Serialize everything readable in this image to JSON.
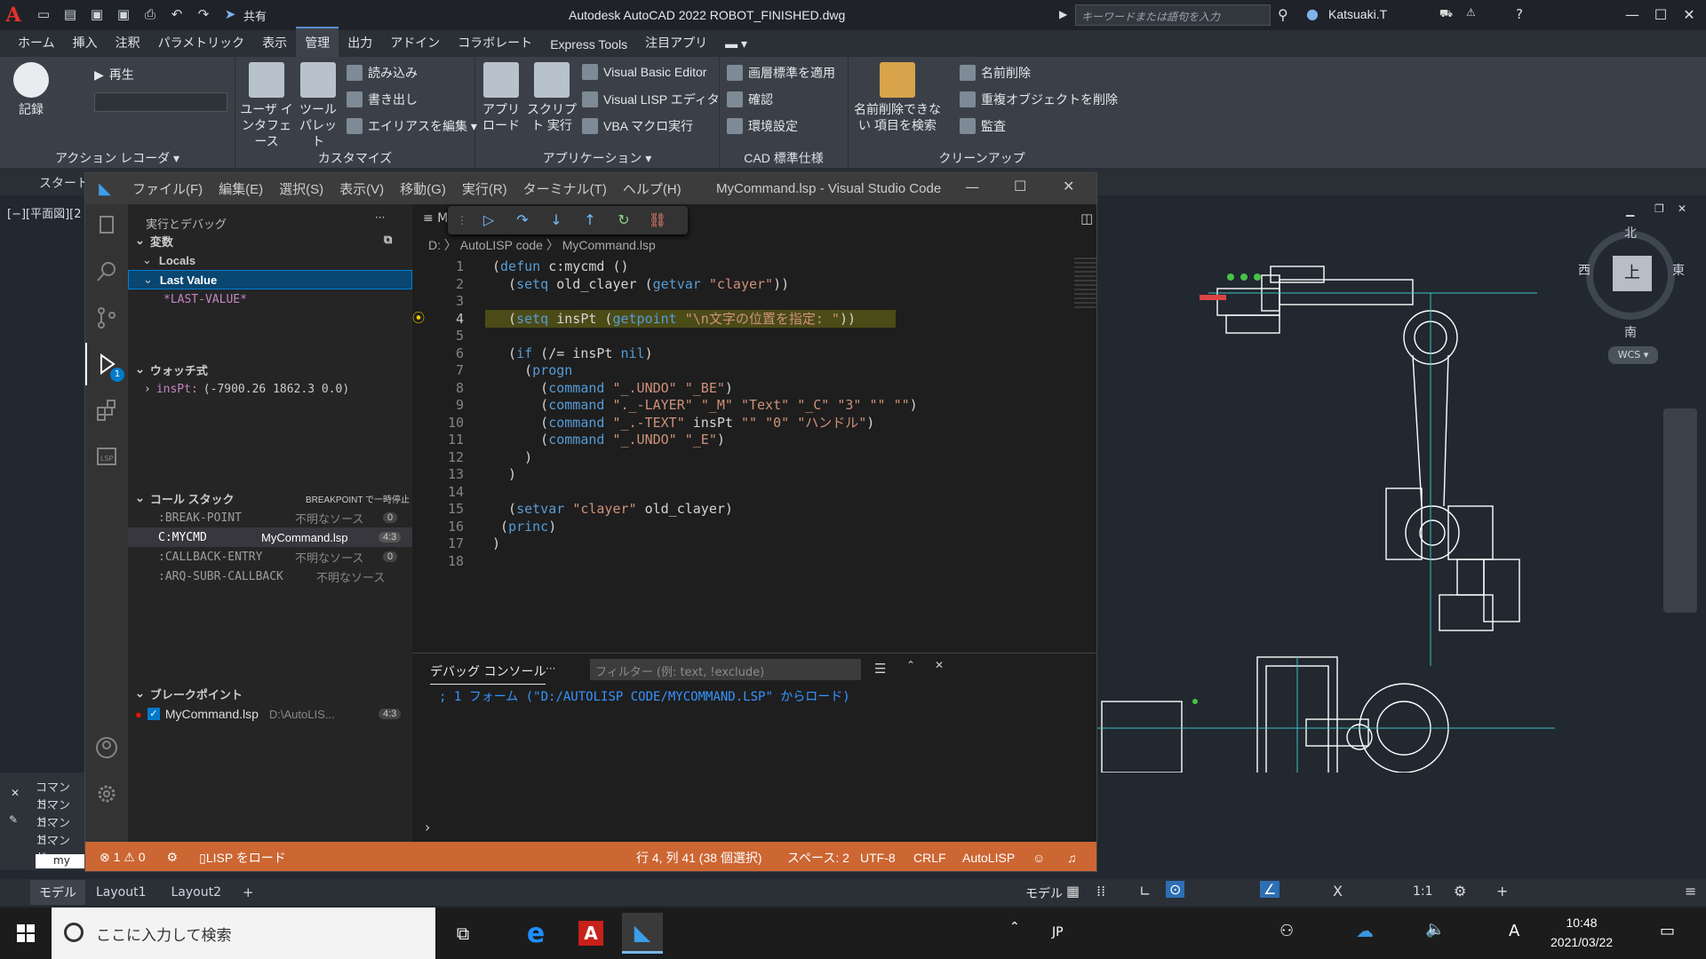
{
  "acad": {
    "title": "Autodesk AutoCAD 2022    ROBOT_FINISHED.dwg",
    "share": "共有",
    "search_placeholder": "キーワードまたは語句を入力",
    "user": "Katsuaki.T",
    "tabs": [
      "ホーム",
      "挿入",
      "注釈",
      "パラメトリック",
      "表示",
      "管理",
      "出力",
      "アドイン",
      "コラボレート",
      "Express Tools",
      "注目アプリ"
    ],
    "active_tab": "管理",
    "ribbon": {
      "action_recorder": {
        "record": "記録",
        "play": "再生",
        "label": "アクション レコーダ ▾"
      },
      "customize": {
        "ui": "ユーザ インタフェース",
        "tool": "ツール パレット",
        "import": "読み込み",
        "export": "書き出し",
        "alias": "エイリアスを編集 ▾",
        "label": "カスタマイズ"
      },
      "applications": {
        "load": "アプリ ロード",
        "script": "スクリプト 実行",
        "vbe": "Visual Basic Editor",
        "vlisp": "Visual LISP エディタ",
        "vba": "VBA マクロ実行",
        "label": "アプリケーション ▾"
      },
      "cad_standards": {
        "apply": "画層標準を適用",
        "check": "確認",
        "config": "環境設定",
        "label": "CAD 標準仕様"
      },
      "cleanup": {
        "find": "名前削除できない 項目を検索",
        "purge": "名前削除",
        "overkill": "重複オブジェクトを削除",
        "audit": "監査",
        "label": "クリーンアップ"
      }
    },
    "file_tab": "スタート",
    "viewport_label": "[−][平面図][2",
    "viewcube": {
      "north": "北",
      "south": "南",
      "east": "東",
      "west": "西",
      "top": "上",
      "wcs": "WCS ▾"
    },
    "command_lines": [
      "コマンド:",
      "コマンド:",
      "コマンド:",
      "コマンド:"
    ],
    "command_input": "my",
    "layout_tabs": [
      "モデル",
      "Layout1",
      "Layout2",
      "+"
    ],
    "status_model": "モデル",
    "status_scale": "1:1"
  },
  "vscode": {
    "menu": [
      "ファイル(F)",
      "編集(E)",
      "選択(S)",
      "表示(V)",
      "移動(G)",
      "実行(R)",
      "ターミナル(T)",
      "ヘルプ(H)"
    ],
    "window_title": "MyCommand.lsp - Visual Studio Code",
    "sidebar_title": "実行とデバッグ",
    "variables_header": "変数",
    "locals": "Locals",
    "last_value": "Last Value",
    "last_value_item": "*LAST-VALUE*",
    "watch_header": "ウォッチ式",
    "watch_name": "insPt:",
    "watch_value": "(-7900.26 1862.3 0.0)",
    "callstack_header": "コール スタック",
    "callstack_state": "BREAKPOINT で一時停止",
    "callstack": [
      {
        "name": ":BREAK-POINT",
        "src": "不明なソース",
        "pos": "0"
      },
      {
        "name": "C:MYCMD",
        "src": "MyCommand.lsp",
        "pos": "4:3"
      },
      {
        "name": ":CALLBACK-ENTRY",
        "src": "不明なソース",
        "pos": "0"
      },
      {
        "name": ":ARQ-SUBR-CALLBACK",
        "src": "不明なソース",
        "pos": ""
      }
    ],
    "breakpoints_header": "ブレークポイント",
    "breakpoint_file": "MyCommand.lsp",
    "breakpoint_path": "D:\\AutoLIS...",
    "breakpoint_pos": "4:3",
    "tab_fragment": "M",
    "breadcrumb": "D: 〉 AutoLISP code 〉  MyCommand.lsp",
    "code": [
      "(defun c:mycmd ()",
      "  (setq old_clayer (getvar \"clayer\"))",
      "",
      "  (setq insPt (getpoint \"\\n文字の位置を指定: \"))",
      "",
      "  (if (/= insPt nil)",
      "    (progn",
      "      (command \"_.UNDO\" \"_BE\")",
      "      (command \"._-LAYER\" \"_M\" \"Text\" \"_C\" \"3\" \"\" \"\")",
      "      (command \"_.-TEXT\" insPt \"\" \"0\" \"ハンドル\")",
      "      (command \"_.UNDO\" \"_E\")",
      "    )",
      "  )",
      "",
      "  (setvar \"clayer\" old_clayer)",
      " (princ)",
      ")",
      ""
    ],
    "line_numbers": [
      "1",
      "2",
      "3",
      "4",
      "5",
      "6",
      "7",
      "8",
      "9",
      "10",
      "11",
      "12",
      "13",
      "14",
      "15",
      "16",
      "17",
      "18"
    ],
    "panel_title": "デバッグ コンソール",
    "panel_more": "···",
    "filter_placeholder": "フィルター (例: text, !exclude)",
    "console_line": "; 1 フォーム (\"D:/AUTOLISP CODE/MYCOMMAND.LSP\" からロード)",
    "status": {
      "problems": "⊗ 1 ⚠ 0",
      "lisp": "LISP をロード",
      "position": "行 4, 列 41 (38 個選択)",
      "spaces": "スペース: 2",
      "encoding": "UTF-8",
      "eol": "CRLF",
      "lang": "AutoLISP"
    },
    "debug_badge": "1"
  },
  "taskbar": {
    "search": "ここに入力して検索",
    "ime": "JP",
    "ime_mode": "A",
    "time": "10:48",
    "date": "2021/03/22"
  }
}
